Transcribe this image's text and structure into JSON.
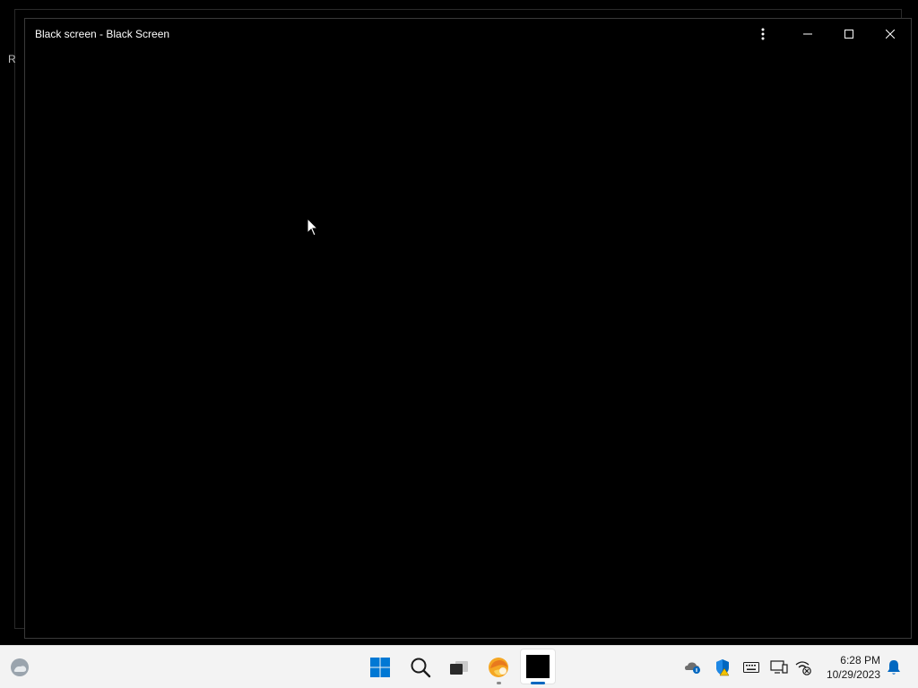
{
  "background_window": {
    "partial_text": "R"
  },
  "window": {
    "title": "Black screen - Black Screen",
    "controls": [
      "more-options",
      "minimize",
      "maximize",
      "close"
    ]
  },
  "taskbar": {
    "left_widget": "weather-icon",
    "pinned": [
      {
        "name": "start",
        "icon": "windows-logo-icon"
      },
      {
        "name": "search",
        "icon": "search-icon"
      },
      {
        "name": "task-view",
        "icon": "task-view-icon"
      },
      {
        "name": "edge",
        "icon": "edge-browser-icon"
      },
      {
        "name": "black-screen-app",
        "icon": "black-square-icon",
        "active": true
      }
    ],
    "tray": [
      "onedrive-icon",
      "windows-security-icon",
      "keyboard-icon",
      "display-icon",
      "network-icon"
    ],
    "clock": {
      "time": "6:28 PM",
      "date": "10/29/2023"
    },
    "notification_icon": "bell-icon"
  },
  "colors": {
    "desktop": "#000000",
    "taskbar": "#f3f3f3",
    "accent": "#0067c0",
    "start_blue": "#0078d4"
  }
}
